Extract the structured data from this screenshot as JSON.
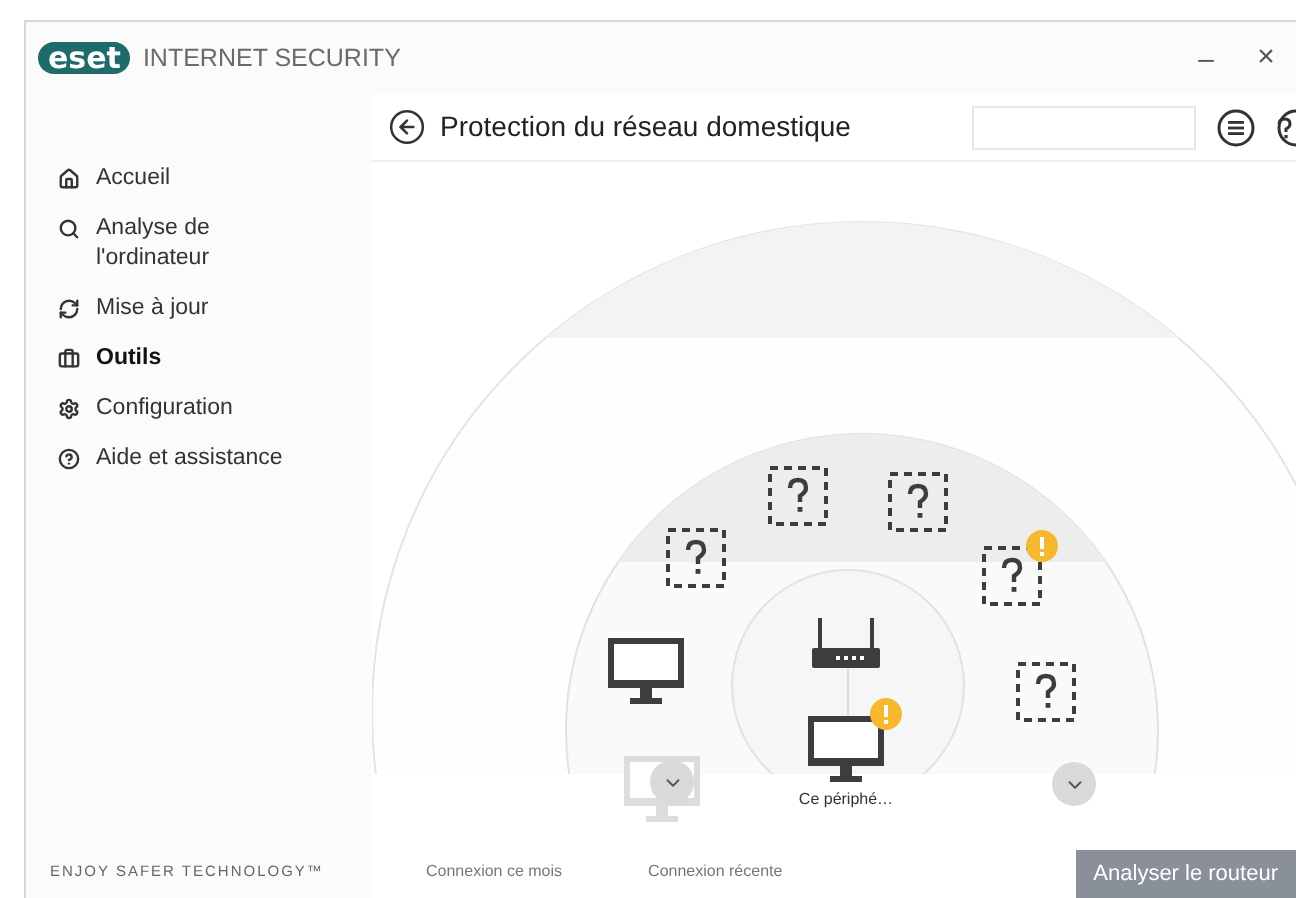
{
  "window": {
    "brand": "eset",
    "product": "INTERNET SECURITY",
    "controls": [
      "–",
      "×"
    ]
  },
  "sidebar": {
    "items": [
      {
        "label": "Accueil",
        "selected": false
      },
      {
        "label": "Analyse de l'ordinateur",
        "selected": false
      },
      {
        "label": "Mise à jour",
        "selected": false
      },
      {
        "label": "Outils",
        "selected": true
      },
      {
        "label": "Configuration",
        "selected": false
      },
      {
        "label": "Aide et assistance",
        "selected": false
      }
    ],
    "slogan": "ENJOY SAFER TECHNOLOGY™"
  },
  "page": {
    "title": "Protection du réseau domestique"
  },
  "devices": [
    {
      "kind": "unknown",
      "warning": false,
      "dimmed": false
    },
    {
      "kind": "unknown",
      "warning": false,
      "dimmed": false
    },
    {
      "kind": "unknown",
      "warning": false,
      "dimmed": false
    },
    {
      "kind": "unknown",
      "warning": true,
      "dimmed": false
    },
    {
      "kind": "unknown",
      "warning": false,
      "dimmed": false
    },
    {
      "kind": "computer",
      "warning": false,
      "dimmed": false
    },
    {
      "kind": "router",
      "warning": false,
      "dimmed": false
    },
    {
      "kind": "computer",
      "warning": true,
      "dimmed": false,
      "label": "Ce périphé…"
    },
    {
      "kind": "computer",
      "warning": false,
      "dimmed": true
    }
  ],
  "legend": [
    "Connexion ce mois",
    "Connexion récente"
  ],
  "scan_button": "Analyser le routeur"
}
